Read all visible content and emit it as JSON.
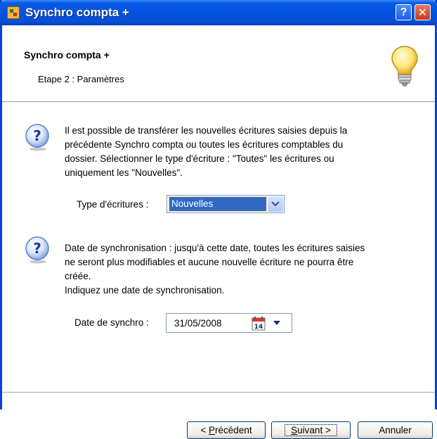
{
  "window": {
    "title": "Synchro compta +",
    "help_label": "?",
    "close_label": "✕"
  },
  "header": {
    "title": "Synchro compta +",
    "subtitle": "Etape 2 : Paramètres"
  },
  "section1": {
    "lines": [
      "Il est possible de transférer les nouvelles écritures saisies depuis la",
      "précédente Synchro compta ou toutes les écritures comptables du",
      "dossier. Sélectionner le type d'écriture : \"Toutes\" les écritures ou",
      "uniquement les \"Nouvelles\"."
    ],
    "field_label": "Type d'écritures :",
    "select_value": "Nouvelles"
  },
  "section2": {
    "lines": [
      "Date de synchronisation : jusqu'à cette date, toutes les écritures saisies",
      "ne seront plus modifiables et aucune nouvelle écriture ne pourra être",
      "créée.",
      "Indiquez une date de synchronisation."
    ],
    "field_label": "Date de synchro :",
    "date_value": "31/05/2008",
    "calendar_day": "14"
  },
  "buttons": {
    "prev_prefix": "< ",
    "prev_accel": "P",
    "prev_rest": "récédent",
    "next_accel": "S",
    "next_rest": "uivant >",
    "cancel": "Annuler"
  },
  "icons": {
    "app": "app-icon",
    "bulb": "lightbulb-icon",
    "question": "question-icon",
    "calendar": "calendar-icon"
  }
}
